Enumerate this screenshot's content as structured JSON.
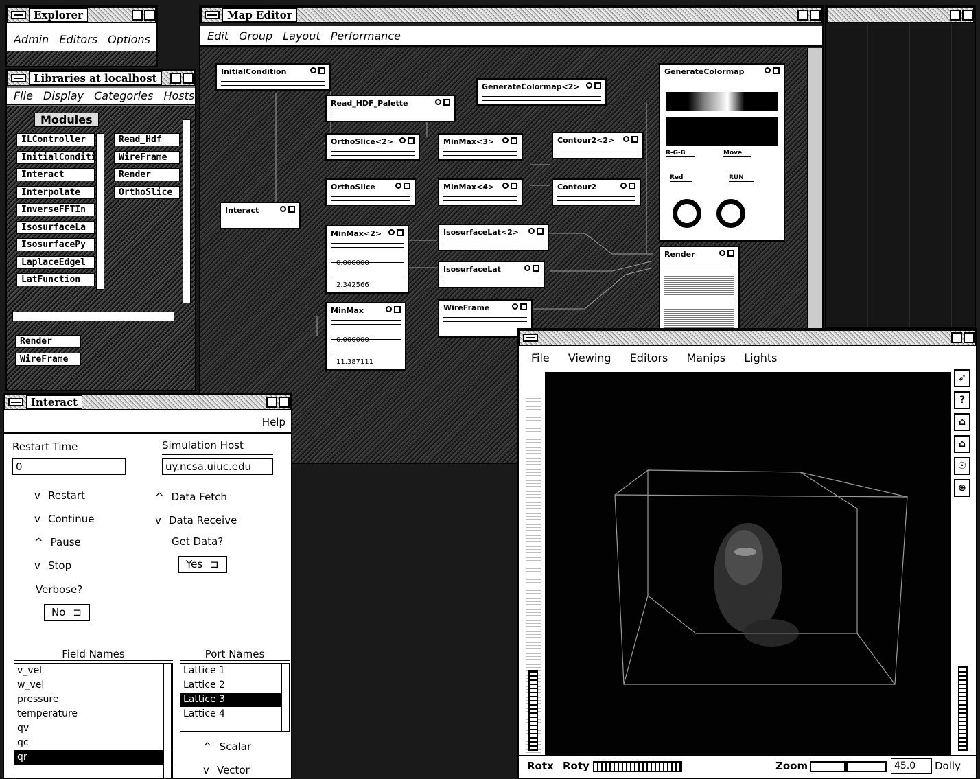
{
  "explorer": {
    "title": "Explorer",
    "menu": [
      "Admin",
      "Editors",
      "Options"
    ]
  },
  "library": {
    "title": "Libraries at localhost",
    "menu": [
      "File",
      "Display",
      "Categories",
      "Hosts"
    ],
    "modules_label": "Modules",
    "modules": [
      "ILController",
      "InitialConditi",
      "Interact",
      "Interpolate",
      "InverseFFTIn",
      "IsosurfaceLa",
      "IsosurfacePy",
      "LaplaceEdgel",
      "LatFunction"
    ],
    "shelf": [
      "Read_Hdf",
      "WireFrame",
      "Render",
      "OrthoSlice"
    ],
    "selected": [
      "Render",
      "WireFrame"
    ]
  },
  "map_editor": {
    "title": "Map Editor",
    "menu": [
      "Edit",
      "Group",
      "Layout",
      "Performance"
    ],
    "modules": {
      "initial_condition": "InitialCondition",
      "read_hdf_palette": "Read_HDF_Palette",
      "generate_colormap2": "GenerateColormap<2>",
      "generate_colormap": "GenerateColormap",
      "orthoslice2": "OrthoSlice<2>",
      "minmax3": "MinMax<3>",
      "contour2_2": "Contour2<2>",
      "orthoslice": "OrthoSlice",
      "minmax4": "MinMax<4>",
      "contour2": "Contour2",
      "interact": "Interact",
      "minmax2": "MinMax<2>",
      "isosurfacelat2": "IsosurfaceLat<2>",
      "isosurfacelat": "IsosurfaceLat",
      "render": "Render",
      "minmax": "MinMax",
      "wireframe": "WireFrame"
    },
    "minmax2_values": [
      "0.000000",
      "2.342566"
    ],
    "minmax_values": [
      "0.000000",
      "11.387111"
    ],
    "colormap_controls": [
      "R-G-B",
      "Move",
      "Red",
      "RUN"
    ]
  },
  "interact": {
    "title": "Interact",
    "help": "Help",
    "restart_time_label": "Restart Time",
    "restart_time_value": "0",
    "sim_host_label": "Simulation Host",
    "sim_host_value": "uy.ncsa.uiuc.edu",
    "actions": [
      "Restart",
      "Continue",
      "Pause",
      "Stop"
    ],
    "action_states": [
      "v",
      "v",
      "^",
      "v"
    ],
    "data_fetch": "Data Fetch",
    "data_receive": "Data Receive",
    "get_data_label": "Get Data?",
    "get_data_value": "Yes",
    "verbose_label": "Verbose?",
    "verbose_value": "No",
    "field_names_header": "Field Names",
    "field_names": [
      "v_vel",
      "w_vel",
      "pressure",
      "temperature",
      "qv",
      "qc",
      "qr"
    ],
    "field_selected_index": 6,
    "port_names_header": "Port Names",
    "port_names": [
      "Lattice 1",
      "Lattice 2",
      "Lattice 3",
      "Lattice 4"
    ],
    "port_selected_index": 2,
    "scalar": "Scalar",
    "vector": "Vector"
  },
  "viewer": {
    "menu": [
      "File",
      "Viewing",
      "Editors",
      "Manips",
      "Lights"
    ],
    "rotx": "Rotx",
    "roty": "Roty",
    "zoom": "Zoom",
    "zoom_value": "45.0",
    "dolly": "Dolly",
    "tools": [
      "pointer-icon",
      "help-icon",
      "home-icon",
      "set-home-icon",
      "view-all-icon",
      "seek-icon"
    ],
    "tool_glyphs": [
      "➶",
      "?",
      "⌂",
      "⌂",
      "☉",
      "⊕"
    ]
  }
}
